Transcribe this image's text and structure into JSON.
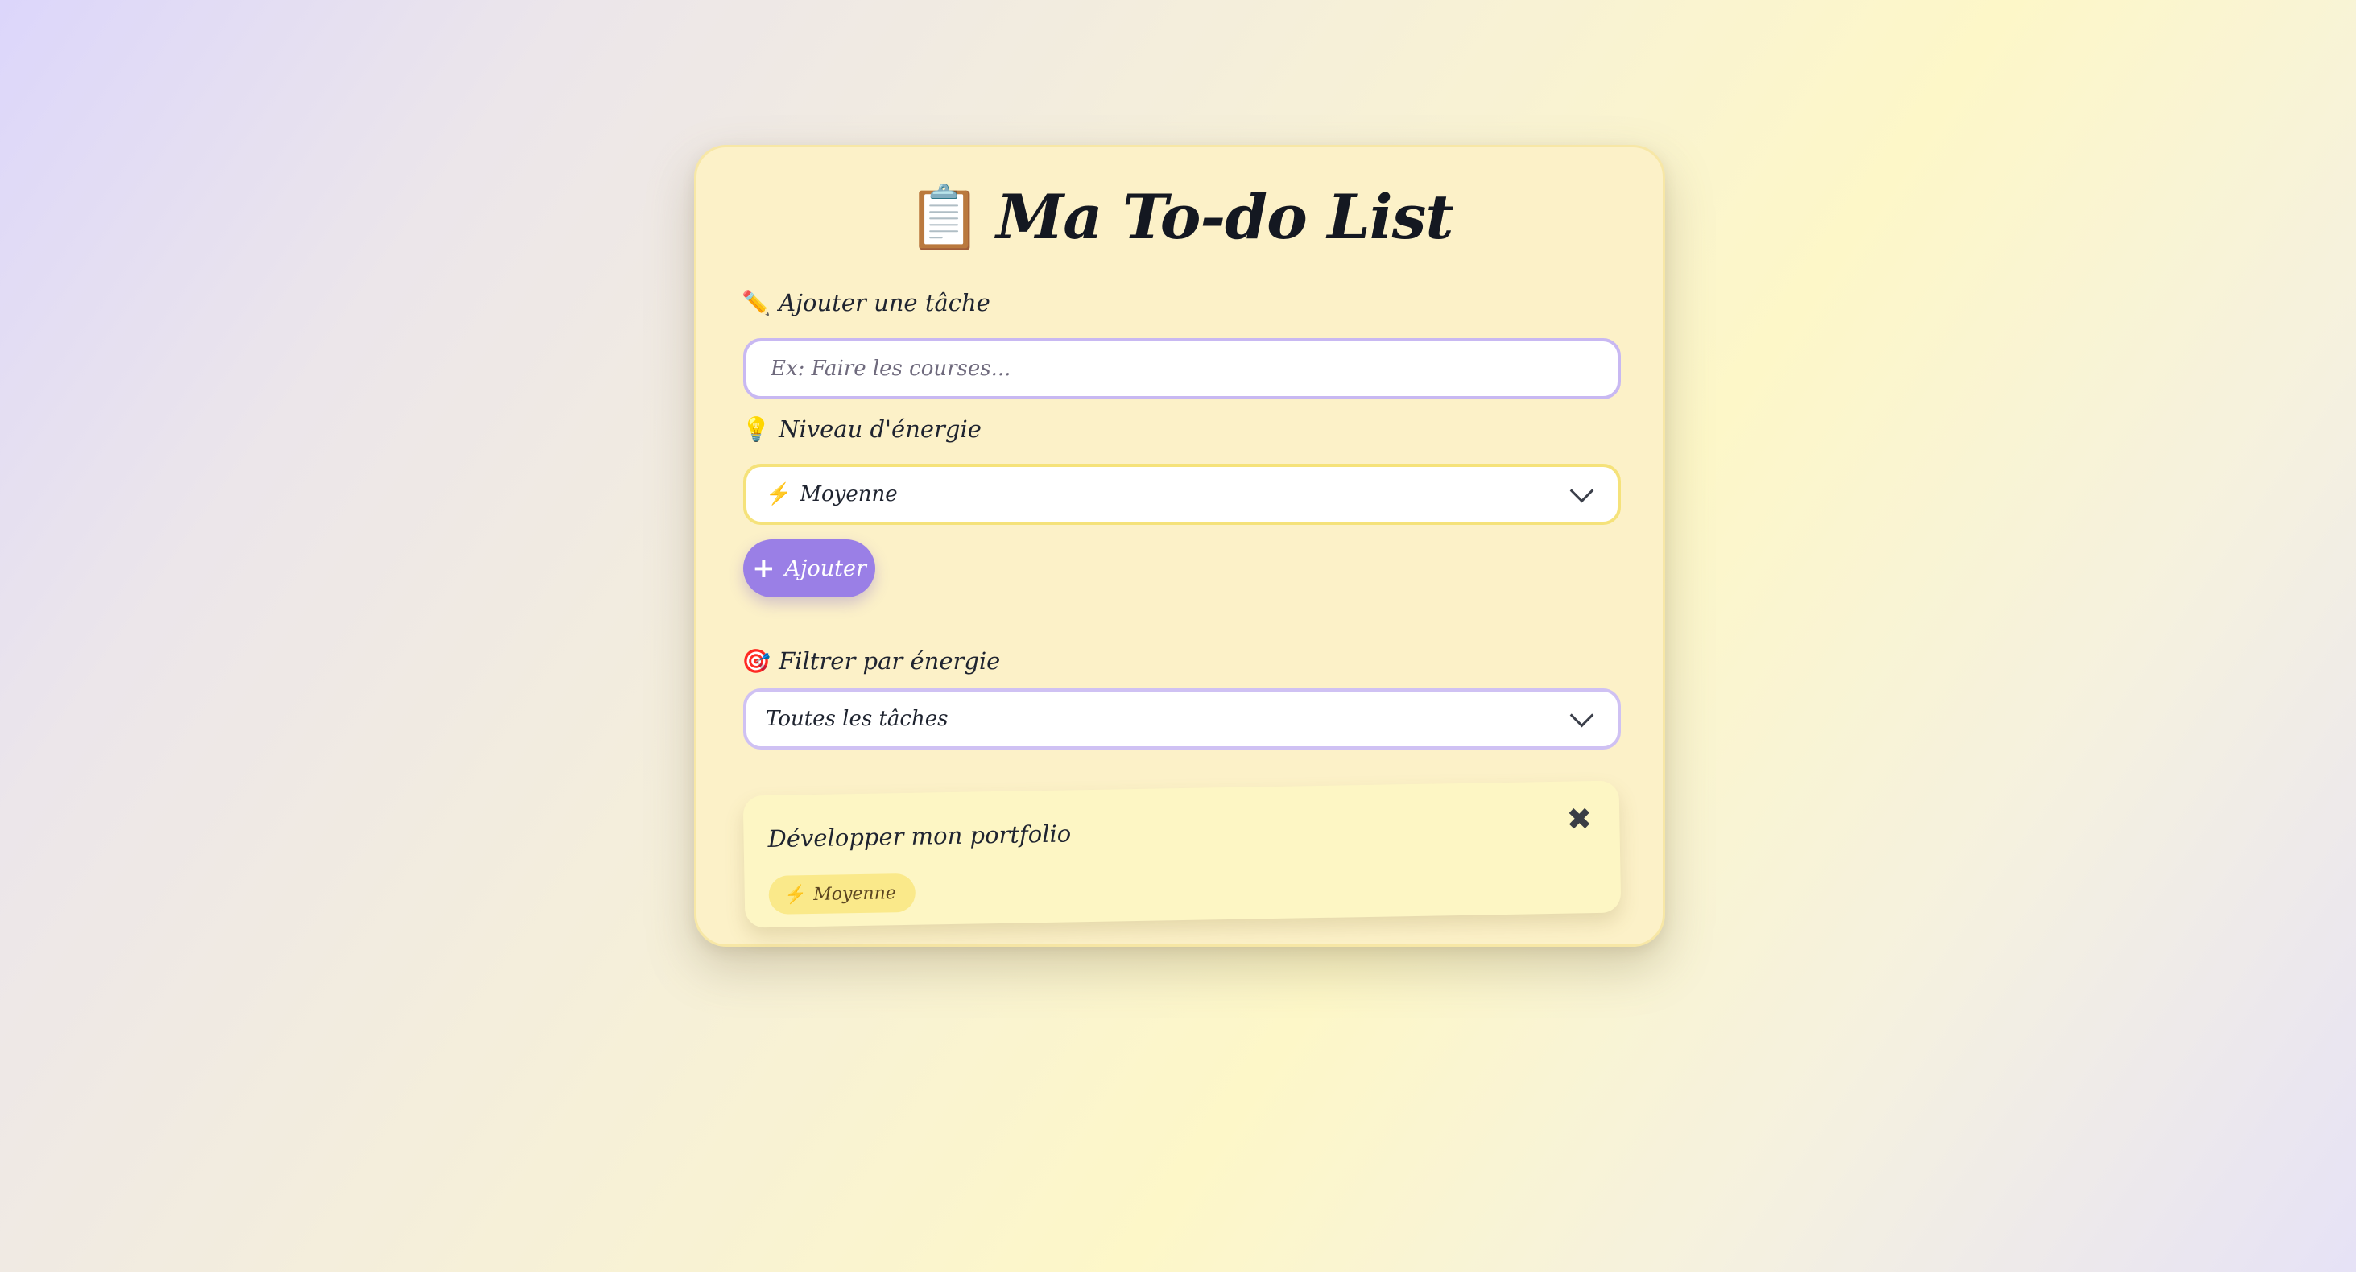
{
  "app": {
    "title": "Ma To-do List",
    "title_icon": "📋"
  },
  "add_task": {
    "label": "Ajouter une tâche",
    "label_icon": "✏️",
    "input_value": "",
    "input_placeholder": "Ex: Faire les courses..."
  },
  "energy": {
    "label": "Niveau d'énergie",
    "label_icon": "💡",
    "selected_icon": "⚡",
    "selected_value": "Moyenne"
  },
  "add_button": {
    "icon": "+",
    "label": "Ajouter"
  },
  "filter": {
    "label": "Filtrer par énergie",
    "label_icon": "🎯",
    "selected_value": "Toutes les tâches"
  },
  "tasks": [
    {
      "title": "Développer mon portfolio",
      "energy_icon": "⚡",
      "energy": "Moyenne",
      "delete_icon": "✖"
    }
  ],
  "colors": {
    "accent_purple": "#9a7fe6",
    "card_background": "#fcf1c8",
    "energy_badge": "#fae98a",
    "energy_select_border": "#f5e27a",
    "filter_select_border": "#cfc1f3"
  }
}
